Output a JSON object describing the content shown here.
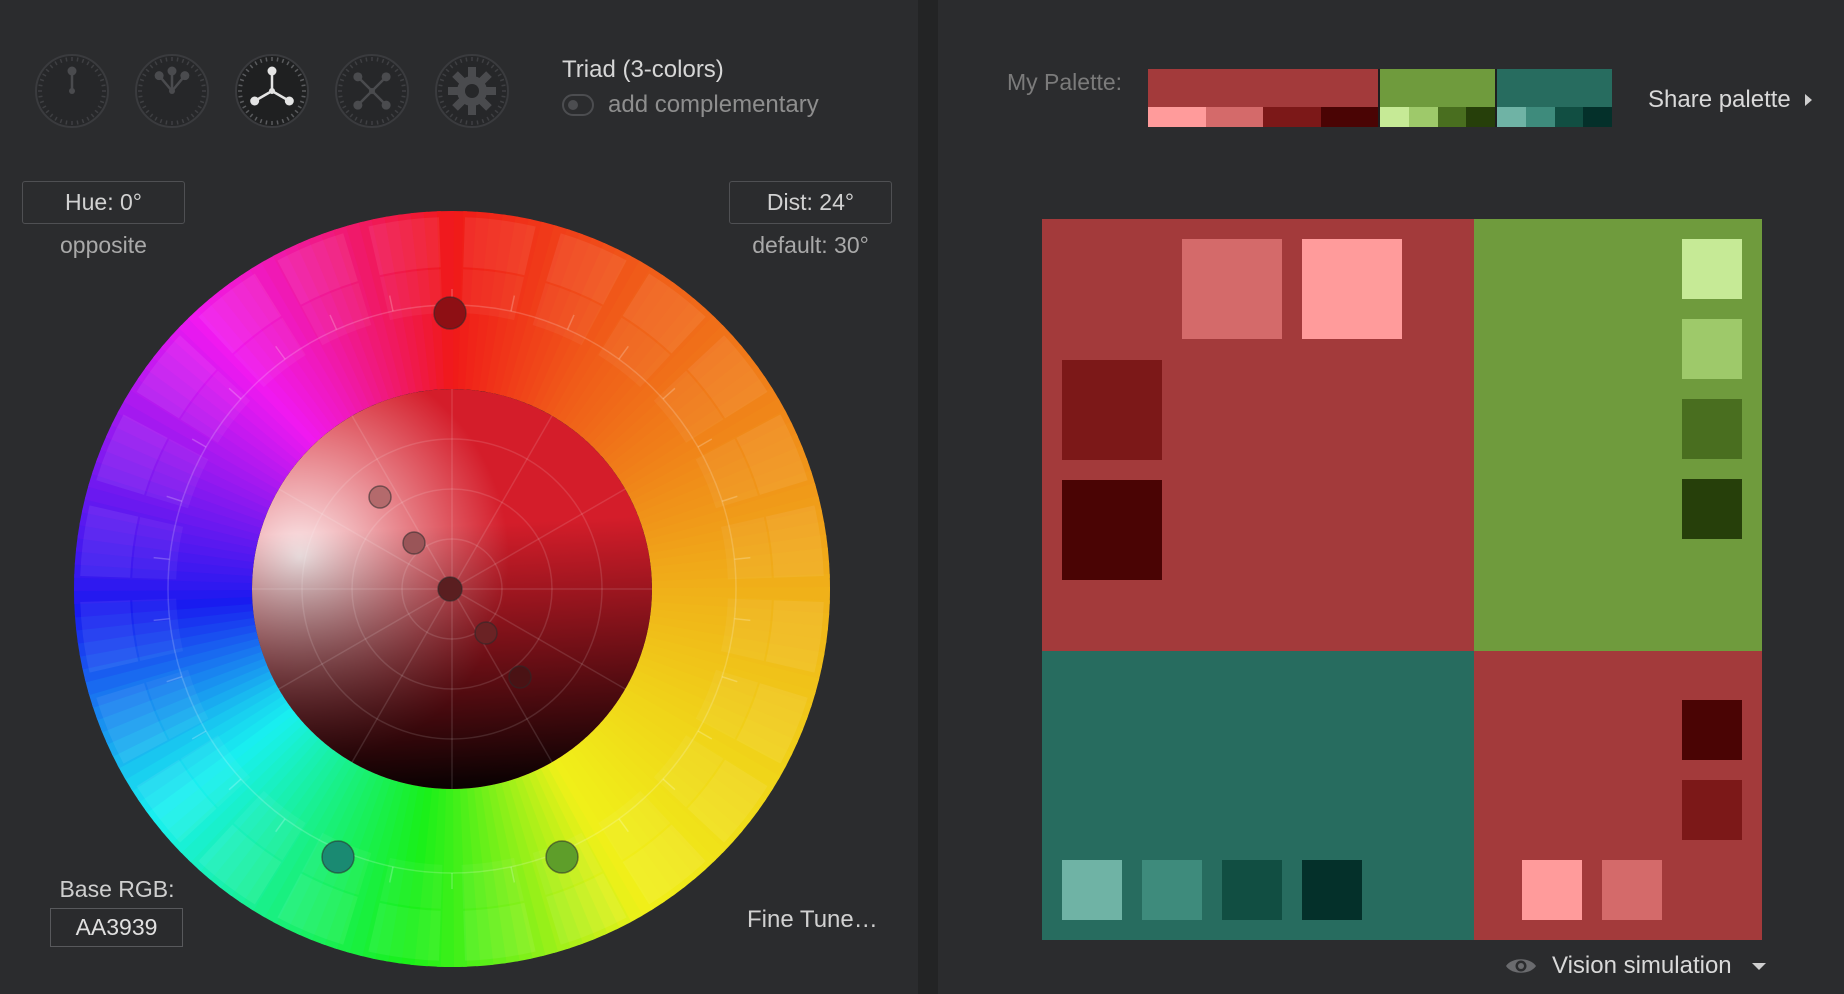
{
  "harmony": {
    "title": "Triad (3-colors)",
    "complementary_label": "add complementary",
    "complementary_enabled": false
  },
  "hue": {
    "label": "Hue: 0°",
    "hint": "opposite"
  },
  "dist": {
    "label": "Dist: 24°",
    "hint": "default: 30°"
  },
  "base": {
    "label": "Base RGB:",
    "value": "AA3939"
  },
  "fine_tune_label": "Fine Tune…",
  "palette": {
    "label": "My Palette:",
    "groups": [
      {
        "main": "#a33a3b",
        "tints": [
          "#ff9b9b",
          "#d46a6a",
          "#7c1818",
          "#4a0404"
        ]
      },
      {
        "main": "#6f9b3d",
        "tints": [
          "#c6ea96",
          "#9ec96a",
          "#496e1f",
          "#263f0a"
        ]
      },
      {
        "main": "#276c5f",
        "tints": [
          "#6fb3a5",
          "#3e8b7c",
          "#114e42",
          "#04302a"
        ]
      }
    ]
  },
  "share_label": "Share palette",
  "vision_label": "Vision simulation",
  "selected_mode": 2,
  "colors": {
    "accent": "#AA3939",
    "secondary_1": "#6F9B3D",
    "secondary_2": "#276C5F"
  },
  "icons": {
    "eye": "eye-icon",
    "caret_right": "caret-right-icon",
    "caret_down": "caret-down-icon"
  }
}
